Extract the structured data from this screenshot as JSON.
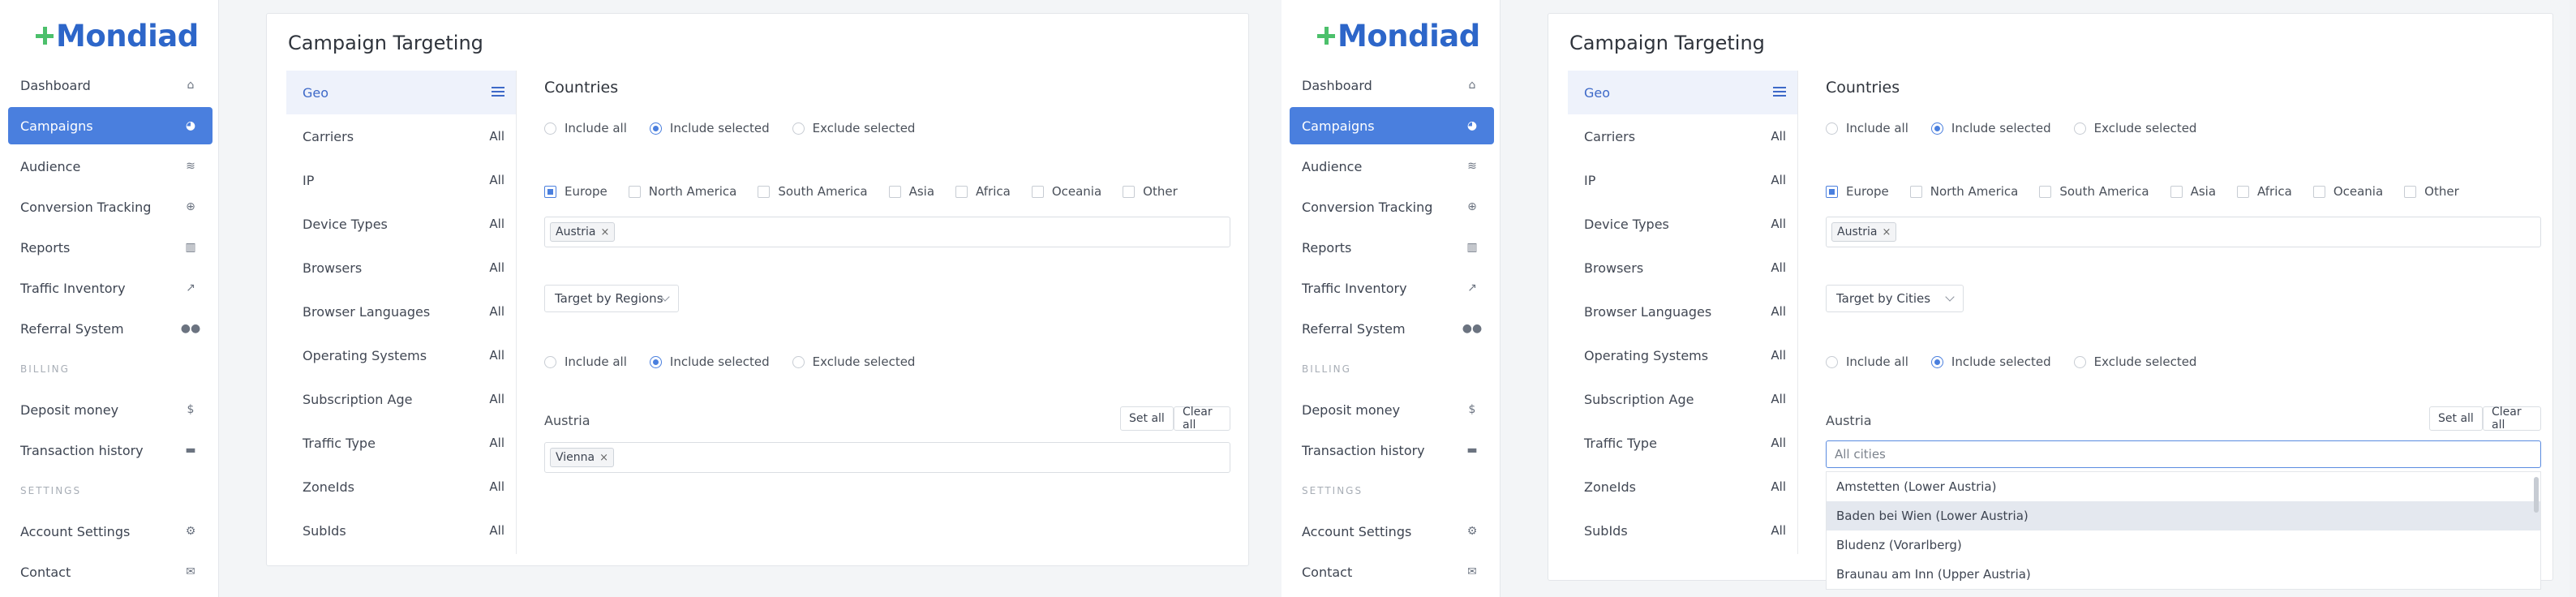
{
  "brand": {
    "name": "Mondiad",
    "primary": "#2d66c9",
    "accent": "#4cc06b",
    "active_bg": "#4a7fde"
  },
  "nav": {
    "items": [
      {
        "label": "Dashboard",
        "icon": "home-icon"
      },
      {
        "label": "Campaigns",
        "icon": "pie-chart-icon",
        "active": true
      },
      {
        "label": "Audience",
        "icon": "layers-icon"
      },
      {
        "label": "Conversion Tracking",
        "icon": "globe-icon"
      },
      {
        "label": "Reports",
        "icon": "bar-chart-icon"
      },
      {
        "label": "Traffic Inventory",
        "icon": "line-chart-icon"
      },
      {
        "label": "Referral System",
        "icon": "users-icon"
      }
    ],
    "billing_heading": "BILLING",
    "billing": [
      {
        "label": "Deposit money",
        "icon": "dollar-icon"
      },
      {
        "label": "Transaction history",
        "icon": "wallet-icon"
      }
    ],
    "settings_heading": "SETTINGS",
    "settings": [
      {
        "label": "Account Settings",
        "icon": "cogs-icon"
      },
      {
        "label": "Contact",
        "icon": "envelope-icon"
      }
    ]
  },
  "card": {
    "title": "Campaign Targeting",
    "tabs": [
      {
        "label": "Geo",
        "value": ""
      },
      {
        "label": "Carriers",
        "value": "All"
      },
      {
        "label": "IP",
        "value": "All"
      },
      {
        "label": "Device Types",
        "value": "All"
      },
      {
        "label": "Browsers",
        "value": "All"
      },
      {
        "label": "Browser Languages",
        "value": "All"
      },
      {
        "label": "Operating Systems",
        "value": "All"
      },
      {
        "label": "Subscription Age",
        "value": "All"
      },
      {
        "label": "Traffic Type",
        "value": "All"
      },
      {
        "label": "ZoneIds",
        "value": "All"
      },
      {
        "label": "SubIds",
        "value": "All"
      }
    ]
  },
  "geo": {
    "countries_title": "Countries",
    "mode_options": [
      "Include all",
      "Include selected",
      "Exclude selected"
    ],
    "mode_selected": "Include selected",
    "continents": [
      "Europe",
      "North America",
      "South America",
      "Asia",
      "Africa",
      "Oceania",
      "Other"
    ],
    "continent_checked": "Europe",
    "selected_country_tag": "Austria",
    "region_label": "Austria",
    "set_all": "Set all",
    "clear_all": "Clear all"
  },
  "left_view": {
    "target_by": "Target by Regions",
    "region_tag": "Vienna"
  },
  "right_view": {
    "target_by": "Target by Cities",
    "search_placeholder": "All cities",
    "city_options": [
      "Amstetten (Lower Austria)",
      "Baden bei Wien (Lower Austria)",
      "Bludenz (Vorarlberg)",
      "Braunau am Inn (Upper Austria)"
    ],
    "highlighted_index": 1
  }
}
